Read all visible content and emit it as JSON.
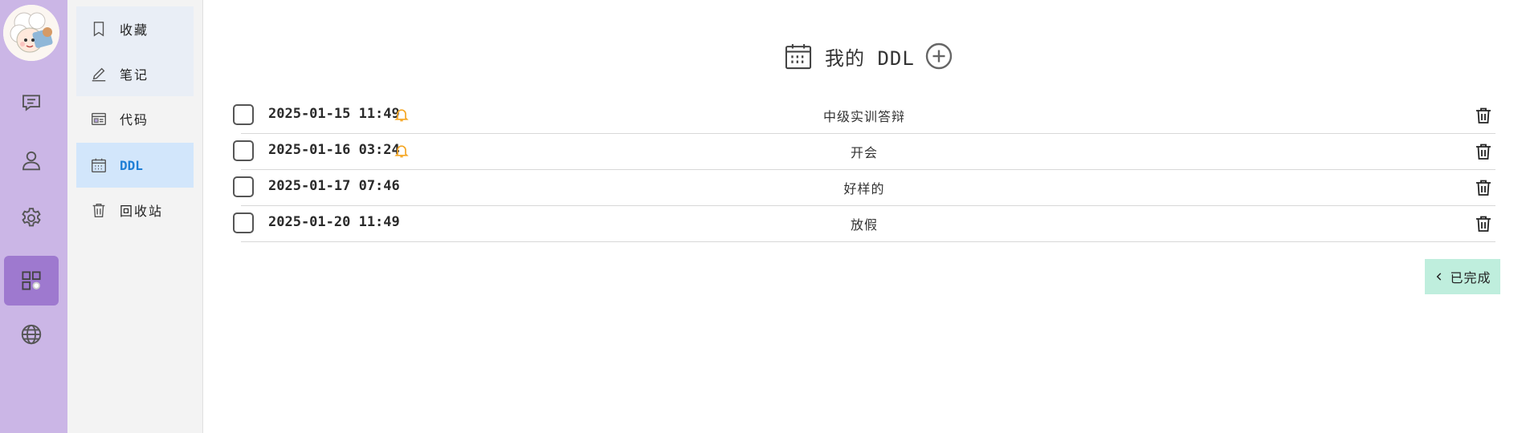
{
  "rail": {
    "items": [
      {
        "icon": "chat-icon"
      },
      {
        "icon": "user-icon"
      },
      {
        "icon": "gear-icon"
      },
      {
        "icon": "apps-icon",
        "active": true
      },
      {
        "icon": "globe-icon"
      }
    ]
  },
  "menu": {
    "items": [
      {
        "label": "收藏",
        "icon": "bookmark-icon"
      },
      {
        "label": "笔记",
        "icon": "pencil-icon"
      },
      {
        "label": "代码",
        "icon": "code-icon"
      },
      {
        "label": "DDL",
        "icon": "calendar-icon",
        "active": true
      },
      {
        "label": "回收站",
        "icon": "trash-icon"
      }
    ]
  },
  "header": {
    "title": "我的 DDL"
  },
  "ddl": {
    "rows": [
      {
        "datetime": "2025-01-15 11:49",
        "reminder": true,
        "task": "中级实训答辩"
      },
      {
        "datetime": "2025-01-16 03:24",
        "reminder": true,
        "task": "开会"
      },
      {
        "datetime": "2025-01-17 07:46",
        "reminder": false,
        "task": "好样的"
      },
      {
        "datetime": "2025-01-20 11:49",
        "reminder": false,
        "task": "放假"
      }
    ]
  },
  "completed_button": {
    "label": "已完成"
  },
  "colors": {
    "rail": "#cbb6e6",
    "rail_active": "#9e79cf",
    "menu_active": "#d2e6fb",
    "menu_active_text": "#1e7fd6",
    "bell": "#f5a623",
    "completed_bg": "#bfeedd"
  }
}
